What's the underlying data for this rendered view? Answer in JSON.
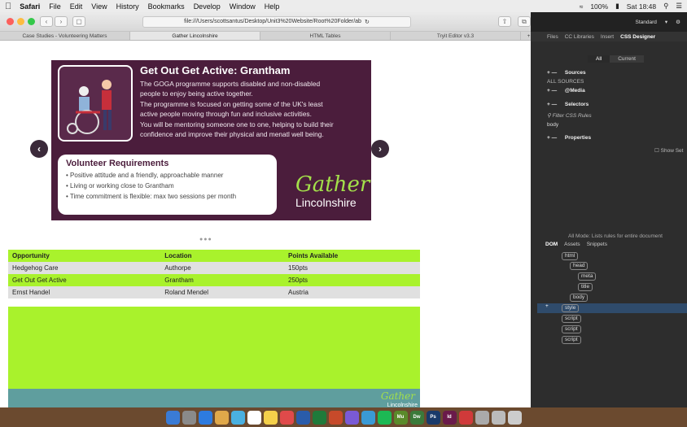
{
  "menubar": {
    "app": "Safari",
    "items": [
      "File",
      "Edit",
      "View",
      "History",
      "Bookmarks",
      "Develop",
      "Window",
      "Help"
    ],
    "battery": "100%",
    "clock": "Sat 18:48"
  },
  "browser": {
    "url": "file:///Users/scottsantus/Desktop/Unit3%20Website/Root%20Folder/ab",
    "tabs": [
      "Case Studies - Volunteering Matters",
      "Gather Lincolnshire",
      "HTML Tables",
      "Tryit Editor v3.3"
    ],
    "active_tab": 1
  },
  "slide": {
    "title": "Get Out Get Active: Grantham",
    "body": [
      "The GOGA programme supports disabled and non-disabled",
      "people to enjoy being active together.",
      "The programme is focused on getting some of the UK's least",
      "active people moving through fun and inclusive activities.",
      "You will be mentoring someone one to one, helping to build their",
      "confidence and improve their physical and menatl well being."
    ],
    "requirements_heading": "Volunteer Requirements",
    "requirements": [
      "Positive attitude and a friendly, approachable manner",
      "Living or working close to Grantham",
      "Time commitment is flexible: max two sessions per month"
    ],
    "logo_line1": "Gather",
    "logo_line2": "Lincolnshire",
    "prev": "‹",
    "next": "›",
    "dots": "●●●"
  },
  "table": {
    "headers": [
      "Opportunity",
      "Location",
      "Points Available"
    ],
    "rows": [
      [
        "Hedgehog Care",
        "Authorpe",
        "150pts"
      ],
      [
        "Get Out Get Active",
        "Grantham",
        "250pts"
      ],
      [
        "Ernst Handel",
        "Roland Mendel",
        "Austria"
      ]
    ]
  },
  "footer": {
    "logo_line1": "Gather",
    "logo_line2": "Lincolnshire"
  },
  "dreamweaver": {
    "workspace": "Standard",
    "panel_tabs": [
      "Files",
      "CC Libraries",
      "Insert",
      "CSS Designer"
    ],
    "seg": [
      "All",
      "Current"
    ],
    "sources": "Sources",
    "all_sources": "ALL SOURCES",
    "media": "@Media",
    "selectors": "Selectors",
    "filter": "Filter CSS Rules",
    "selector_value": "body",
    "properties": "Properties",
    "show_set": "Show Set",
    "mode_text": "All Mode: Lists rules for entire document",
    "dom_tabs": [
      "DOM",
      "Assets",
      "Snippets"
    ],
    "nodes": [
      "html",
      "head",
      "meta",
      "title",
      "body",
      "style",
      "script",
      "script",
      "script"
    ]
  },
  "dock": {
    "labels": [
      "Mu",
      "Dw",
      "Ps",
      "Id"
    ]
  }
}
